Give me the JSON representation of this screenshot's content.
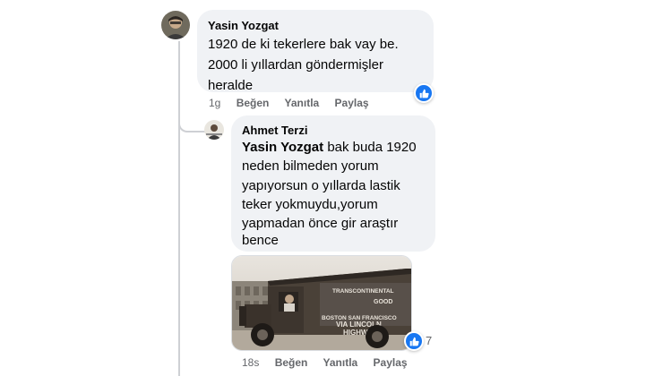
{
  "comment": {
    "author": "Yasin Yozgat",
    "text_lines": [
      "1920 de ki tekerlere bak vay be.",
      "2000 li yıllardan göndermişler",
      "heralde"
    ],
    "timestamp": "1g",
    "actions": {
      "like": "Beğen",
      "reply": "Yanıtla",
      "share": "Paylaş"
    }
  },
  "reply": {
    "author": "Ahmet Terzi",
    "mention": "Yasin Yozgat",
    "text_first_line_rest": " bak buda 1920",
    "text_lines": [
      "neden bilmeden yorum",
      "yapıyorsun o yıllarda lastik",
      "teker yokmuydu,yorum",
      "yapmadan önce gir araştır",
      "bence"
    ],
    "photo_sign_lines": [
      "TRANSCONTINENTAL",
      "GOOD",
      "BOSTON SAN FRANCISCO",
      "VIA LINCOLN",
      "HIGHWAY"
    ],
    "reaction_count": "7",
    "timestamp": "18s",
    "actions": {
      "like": "Beğen",
      "reply": "Yanıtla",
      "share": "Paylaş"
    }
  },
  "colors": {
    "like_blue": "#1877f2",
    "bubble_bg": "#f0f2f5",
    "meta_gray": "#65676b"
  },
  "icons": {
    "reaction": "like-thumb-icon"
  }
}
